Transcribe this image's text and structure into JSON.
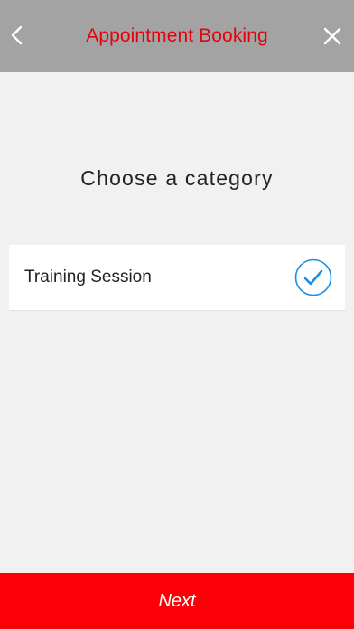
{
  "header": {
    "title": "Appointment Booking",
    "title_color": "#e8000b",
    "background": "#a3a3a3",
    "back_icon": "chevron-left-icon",
    "close_icon": "close-icon"
  },
  "main": {
    "heading": "Choose a category",
    "categories": [
      {
        "label": "Training Session",
        "selected": true,
        "icon": "checkmark-circle-icon",
        "check_color": "#1c8fe3"
      }
    ]
  },
  "footer": {
    "next_label": "Next",
    "next_color": "#fb0007"
  }
}
